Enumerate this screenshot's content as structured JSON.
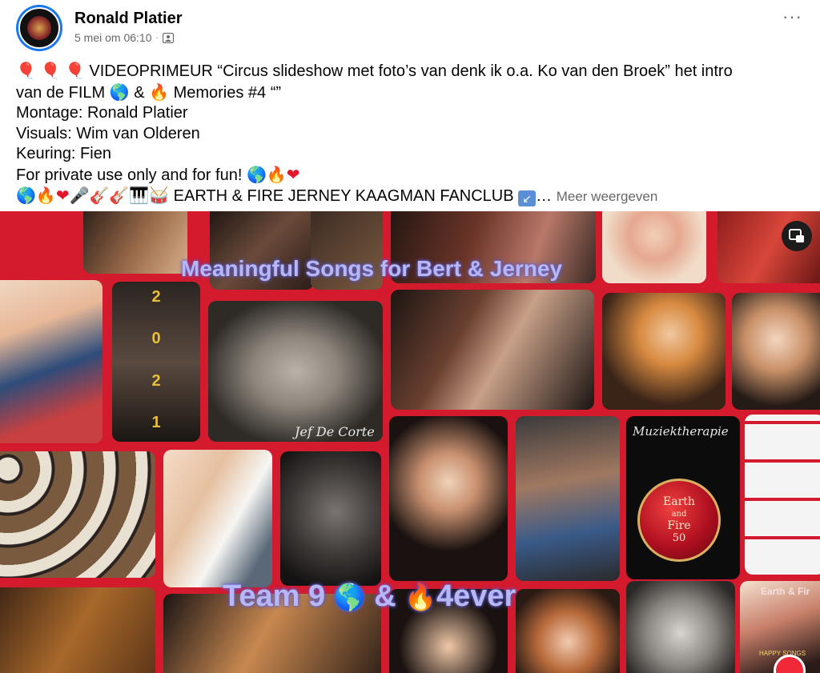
{
  "post": {
    "author": "Ronald Platier",
    "date": "5 mei om 06:10",
    "meta_separator": "·",
    "more_icon": "···",
    "lines": [
      "VIDEOPRIMEUR “Circus slideshow met foto’s van denk ik o.a. Ko van den Broek” het intro",
      "van de FILM",
      "&",
      "Memories #4 “”",
      "Montage: Ronald Platier",
      "Visuals: Wim van Olderen",
      "Keuring: Fien",
      "For private use only and for fun!",
      "EARTH & FIRE JERNEY KAAGMAN FANCLUB",
      "Meer weergeven"
    ],
    "ellipsis": "…",
    "icons": [
      "balloon-icon",
      "globe-icon",
      "fire-icon",
      "heart-icon",
      "microphone-icon",
      "guitar-icon",
      "piano-icon",
      "drum-icon",
      "arrow-icon"
    ]
  },
  "media": {
    "overlay_title": "Meaningful Songs for Bert & Jerney",
    "overlay_bottom": [
      "Team 9",
      "&",
      "4ever"
    ],
    "caption_painting": "Jef De Corte",
    "caption_ornament_top": "Muziektherapie",
    "caption_ornament": [
      "Earth",
      "and",
      "Fire",
      "50"
    ],
    "caption_corner": "Earth & Fir",
    "caption_corner_sub": "HAPPY SONGS",
    "digits": [
      "2",
      "0",
      "2",
      "1"
    ],
    "background_color": "#d41a2d"
  }
}
